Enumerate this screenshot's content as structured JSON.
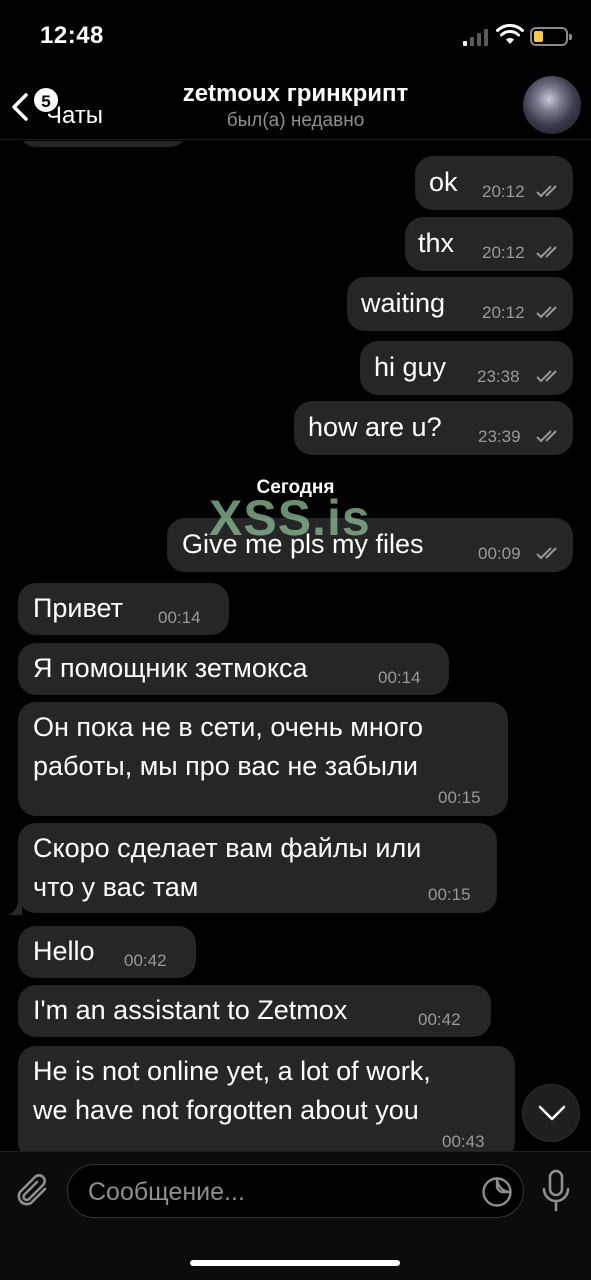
{
  "status_bar": {
    "time": "12:48"
  },
  "header": {
    "back_label": "Чаты",
    "unread_badge": "5",
    "title": "zetmoux гринкрипт",
    "subtitle": "был(а) недавно"
  },
  "messages": [
    {
      "side": "out",
      "text": "ok",
      "time": "20:12",
      "read": true
    },
    {
      "side": "out",
      "text": "thx",
      "time": "20:12",
      "read": true
    },
    {
      "side": "out",
      "text": "waiting",
      "time": "20:12",
      "read": true
    },
    {
      "side": "out",
      "text": "hi guy",
      "time": "23:38",
      "read": true
    },
    {
      "side": "out",
      "text": "how are u?",
      "time": "23:39",
      "read": true
    },
    {
      "side": "out",
      "text": "Give me pls my files",
      "time": "00:09",
      "read": true
    },
    {
      "side": "in",
      "text": "Привет",
      "time": "00:14"
    },
    {
      "side": "in",
      "text": "Я помощник зетмокса",
      "time": "00:14"
    },
    {
      "side": "in",
      "lines": [
        "Он пока не в сети, очень много",
        "работы, мы про вас не забыли"
      ],
      "time": "00:15"
    },
    {
      "side": "in",
      "lines": [
        "Скоро сделает вам файлы или",
        "что у вас там"
      ],
      "time": "00:15"
    },
    {
      "side": "in",
      "text": "Hello",
      "time": "00:42"
    },
    {
      "side": "in",
      "text": "I'm an assistant to Zetmox",
      "time": "00:42"
    },
    {
      "side": "in",
      "lines": [
        "He is not online yet, a lot of work,",
        "we have not forgotten about you"
      ],
      "time": "00:43"
    }
  ],
  "date_separator": "Сегодня",
  "watermark": "XSS.is",
  "composer": {
    "placeholder": "Сообщение..."
  },
  "icons": {
    "back": "chevron-left-icon",
    "scroll_down": "chevron-down-icon",
    "attach": "paperclip-icon",
    "sticker": "sticker-icon",
    "mic": "microphone-icon",
    "read_receipt": "double-check-icon"
  },
  "colors": {
    "background": "#000000",
    "bubble": "#262628",
    "timestamp": "#98989d",
    "battery": "#f7c948"
  }
}
